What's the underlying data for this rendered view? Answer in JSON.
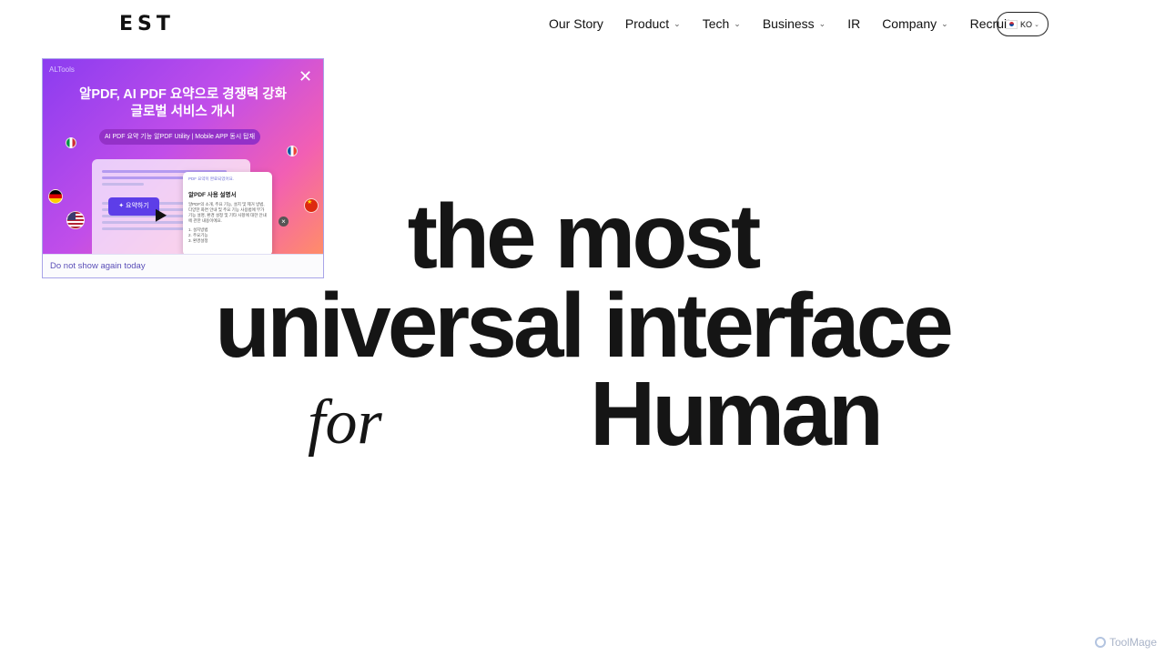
{
  "header": {
    "logo": "EST",
    "nav": [
      {
        "label": "Our Story",
        "dropdown": false
      },
      {
        "label": "Product",
        "dropdown": true
      },
      {
        "label": "Tech",
        "dropdown": true
      },
      {
        "label": "Business",
        "dropdown": true
      },
      {
        "label": "IR",
        "dropdown": false
      },
      {
        "label": "Company",
        "dropdown": true
      },
      {
        "label": "Recruit",
        "dropdown": false
      }
    ],
    "language": "KO"
  },
  "popup": {
    "brand": "ALTools",
    "title_line1": "알PDF, AI PDF 요약으로 경쟁력 강화",
    "title_line2": "글로벌 서비스 개시",
    "pill": "AI PDF 요약 기능 알PDF Utility  |  Mobile APP 동시 탑재",
    "summarize_button": "요약하기",
    "doc_header": "PDF 요약이 완료되었어요.",
    "doc_title": "알PDF 사용 설명서",
    "doc_body": "알PDF의 소개, 주요 기능, 설치 및 제거 방법, 다양한 화면 안내 및 주요 기능 사용법에 부가 기능 설명, 환경 설정 및 기타 사항에 대한 안내에 관한 내용이에요.",
    "doc_list": [
      "1. 설치방법",
      "2. 주요기능",
      "3. 환경설정"
    ],
    "footer": "Do not show again today"
  },
  "hero": {
    "line1": "the most",
    "line2": "universal interface",
    "for": "for",
    "human": "Human"
  },
  "watermark": "ToolMage"
}
